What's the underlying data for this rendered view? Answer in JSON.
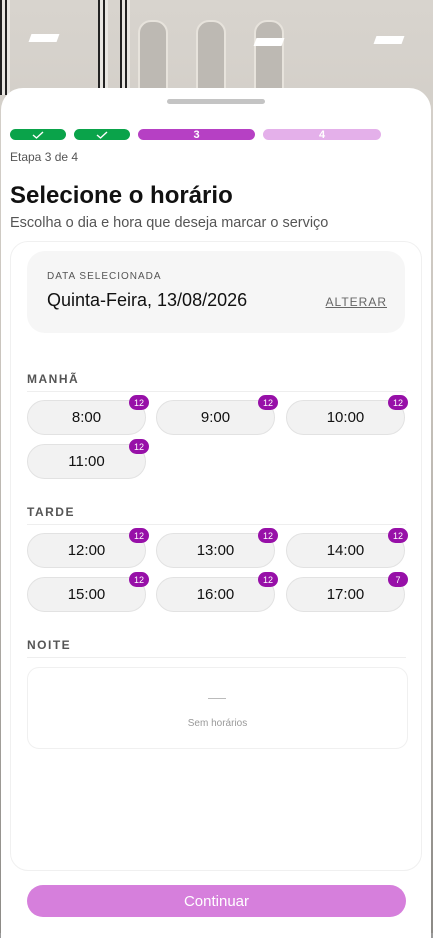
{
  "steps": [
    {
      "label": "",
      "state": "done",
      "icon": "check-icon"
    },
    {
      "label": "",
      "state": "done",
      "icon": "check-icon"
    },
    {
      "label": "3",
      "state": "current"
    },
    {
      "label": "4",
      "state": "todo"
    }
  ],
  "step_label": "Etapa 3 de 4",
  "title": "Selecione o horário",
  "subtitle": "Escolha o dia e hora que deseja marcar o serviço",
  "date": {
    "caption": "DATA SELECIONADA",
    "value": "Quinta-Feira, 13/08/2026",
    "change_label": "ALTERAR"
  },
  "periods": {
    "morning": {
      "title": "MANHÃ",
      "slots": [
        {
          "time": "8:00",
          "count": "12"
        },
        {
          "time": "9:00",
          "count": "12"
        },
        {
          "time": "10:00",
          "count": "12"
        },
        {
          "time": "11:00",
          "count": "12"
        }
      ]
    },
    "afternoon": {
      "title": "TARDE",
      "slots": [
        {
          "time": "12:00",
          "count": "12"
        },
        {
          "time": "13:00",
          "count": "12"
        },
        {
          "time": "14:00",
          "count": "12"
        },
        {
          "time": "15:00",
          "count": "12"
        },
        {
          "time": "16:00",
          "count": "12"
        },
        {
          "time": "17:00",
          "count": "7"
        }
      ]
    },
    "night": {
      "title": "NOITE",
      "empty_text": "Sem horários"
    }
  },
  "continue_label": "Continuar",
  "colors": {
    "done": "#0aa34a",
    "current": "#b640c4",
    "todo": "#e4b0ea",
    "badge": "#9710a8",
    "button": "#d67fdc"
  }
}
